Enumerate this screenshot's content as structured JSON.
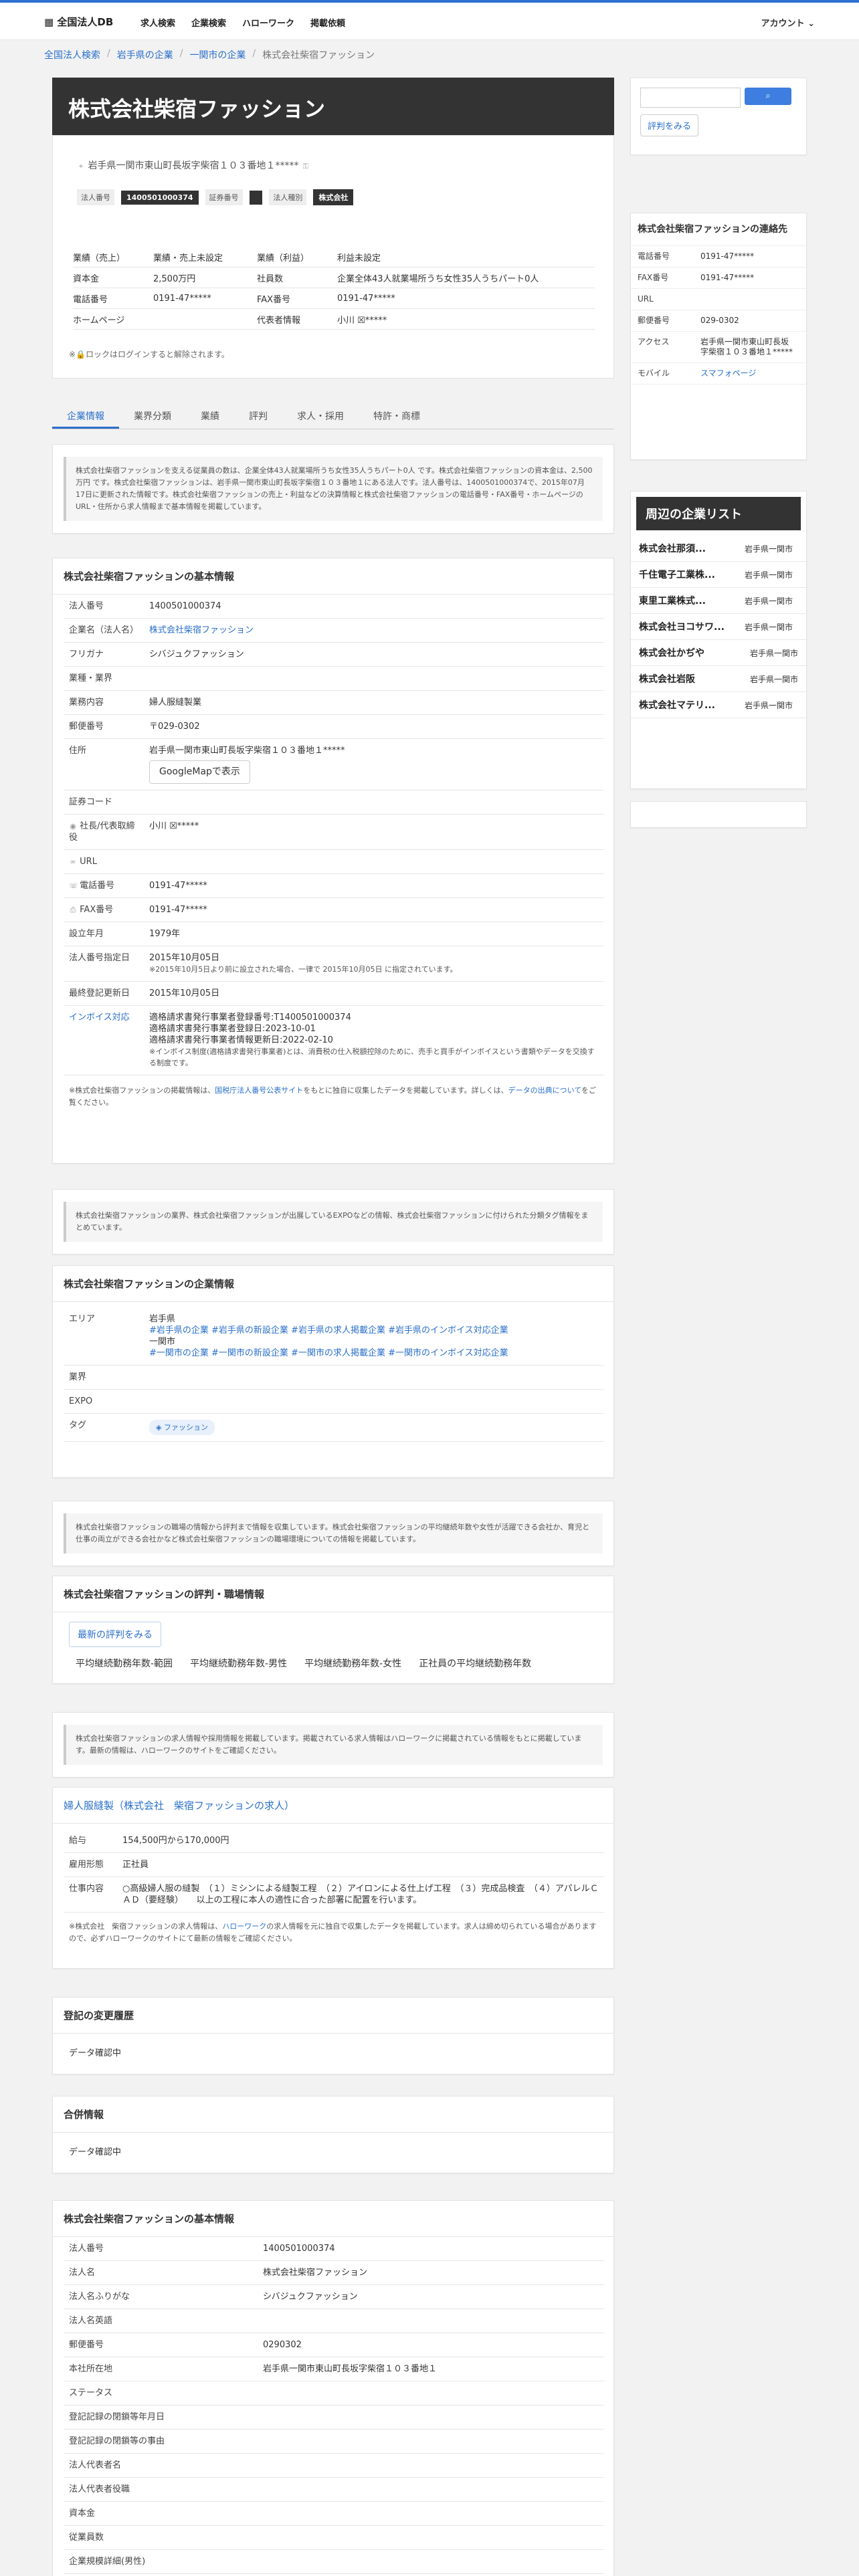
{
  "header": {
    "logo": "全国法人DB",
    "nav": [
      "求人検索",
      "企業検索",
      "ハローワーク",
      "掲載依頼"
    ],
    "account": "アカウント"
  },
  "breadcrumb": [
    "全国法人検索",
    "岩手県の企業",
    "一関市の企業",
    "株式会社柴宿ファッション"
  ],
  "company": {
    "name": "株式会社柴宿ファッション",
    "address": "岩手県一関市東山町長坂字柴宿１０３番地１*****",
    "corp_no_label": "法人番号",
    "corp_no": "1400501000374",
    "stock_label": "証券番号",
    "type_label": "法人種別",
    "type": "株式会社",
    "lock_note": "※🔒ロックはログインすると解除されます。"
  },
  "summary": [
    [
      "業績（売上）",
      "業績・売上未設定",
      "業績（利益）",
      "利益未設定"
    ],
    [
      "資本金",
      "2,500万円",
      "社員数",
      "企業全体43人就業場所うち女性35人うちパート0人"
    ],
    [
      "電話番号",
      "0191-47*****",
      "FAX番号",
      "0191-47*****"
    ],
    [
      "ホームページ",
      "",
      "代表者情報",
      "小川 ☒*****"
    ]
  ],
  "tabs": [
    "企業情報",
    "業界分類",
    "業績",
    "評判",
    "求人・採用",
    "特許・商標"
  ],
  "intro_text": "株式会社柴宿ファッションを支える従業員の数は、企業全体43人就業場所うち女性35人うちパート0人 です。株式会社柴宿ファッションの資本金は、2,500万円 です。株式会社柴宿ファッションは、岩手県一関市東山町長坂字柴宿１０３番地１にある法人です。法人番号は、1400501000374で、2015年07月17日に更新された情報です。株式会社柴宿ファッションの売上・利益などの決算情報と株式会社柴宿ファッションの電話番号・FAX番号・ホームページのURL・住所から求人情報まで基本情報を掲載しています。",
  "basic": {
    "title": "株式会社柴宿ファッションの基本情報",
    "rows": [
      {
        "k": "法人番号",
        "v": "1400501000374"
      },
      {
        "k": "企業名（法人名）",
        "v": "株式会社柴宿ファッション",
        "link": true
      },
      {
        "k": "フリガナ",
        "v": "シバジュクファッション"
      },
      {
        "k": "業種・業界",
        "v": ""
      },
      {
        "k": "業務内容",
        "v": "婦人服縫製業"
      },
      {
        "k": "郵便番号",
        "v": "〒029-0302"
      },
      {
        "k": "住所",
        "v": "岩手県一関市東山町長坂字柴宿１０３番地１*****",
        "btn": "GoogleMapで表示"
      },
      {
        "k": "証券コード",
        "v": ""
      },
      {
        "k": "社長/代表取締役",
        "v": "小川 ☒*****"
      },
      {
        "k": "URL",
        "v": ""
      },
      {
        "k": "電話番号",
        "v": "0191-47*****"
      },
      {
        "k": "FAX番号",
        "v": "0191-47*****"
      },
      {
        "k": "設立年月",
        "v": "1979年"
      },
      {
        "k": "法人番号指定日",
        "v": "2015年10月05日",
        "sub": "※2015年10月5日より前に設立された場合、一律で 2015年10月05日 に指定されています。"
      },
      {
        "k": "最終登記更新日",
        "v": "2015年10月05日"
      },
      {
        "k": "インボイス対応",
        "v": "適格請求書発行事業者登録番号:T1400501000374",
        "v2": "適格請求書発行事業者登録日:2023-10-01",
        "v3": "適格請求書発行事業者情報更新日:2022-02-10",
        "sub": "※インボイス制度(適格請求書発行事業者)とは、消費税の仕入税額控除のために、売手と買手がインボイスという書類やデータを交換する制度です。",
        "link": true
      }
    ],
    "note_pre": "※株式会社柴宿ファッションの掲載情報は、",
    "note_link": "国税庁法人番号公表サイト",
    "note_mid": "をもとに独自に収集したデータを掲載しています。詳しくは、",
    "note_link2": "データの出典について",
    "note_post": "をご覧ください。"
  },
  "industry_intro": "株式会社柴宿ファッションの業界、株式会社柴宿ファッションが出展しているEXPOなどの情報、株式会社柴宿ファッションに付けられた分類タグ情報をまとめています。",
  "industry": {
    "title": "株式会社柴宿ファッションの企業情報",
    "area_label": "エリア",
    "area_pref": "岩手県",
    "area_pref_tags": "#岩手県の企業 #岩手県の新設企業 #岩手県の求人掲載企業 #岩手県のインボイス対応企業",
    "area_city": "一関市",
    "area_city_tags": "#一関市の企業 #一関市の新設企業 #一関市の求人掲載企業 #一関市のインボイス対応企業",
    "industry_label": "業界",
    "expo_label": "EXPO",
    "tag_label": "タグ",
    "tag": "ファッション"
  },
  "reputation_intro": "株式会社柴宿ファッションの職場の情報から評判まで情報を収集しています。株式会社柴宿ファッションの平均継続年数や女性が活躍できる会社か、育児と仕事の両立ができる会社かなど株式会社柴宿ファッションの職場環境についての情報を掲載しています。",
  "reputation": {
    "title": "株式会社柴宿ファッションの評判・職場情報",
    "button": "最新の評判をみる",
    "cols": [
      "平均継続勤務年数-範囲",
      "平均継続勤務年数-男性",
      "平均継続勤務年数-女性",
      "正社員の平均継続勤務年数"
    ]
  },
  "jobs_intro": "株式会社柴宿ファッションの求人情報や採用情報を掲載しています。掲載されている求人情報はハローワークに掲載されている情報をもとに掲載しています。最新の情報は、ハローワークのサイトをご確認ください。",
  "jobs": {
    "title": "婦人服縫製（株式会社　柴宿ファッションの求人）",
    "rows": [
      {
        "k": "給与",
        "v": "154,500円から170,000円"
      },
      {
        "k": "雇用形態",
        "v": "正社員"
      },
      {
        "k": "仕事内容",
        "v": "○高級婦人服の縫製　（１）ミシンによる縫製工程　（２）アイロンによる仕上げ工程　（３）完成品検査　（４）アパレルＣＡＤ（要経験）　　以上の工程に本人の適性に合った部署に配置を行います。"
      }
    ],
    "note_pre": "※株式会社　柴宿ファッションの求人情報は、",
    "note_link": "ハローワーク",
    "note_post": "の求人情報を元に独自で収集したデータを掲載しています。求人は締め切られている場合がありますので、必ずハローワークのサイトにて最新の情報をご確認ください。"
  },
  "history": {
    "title": "登記の変更履歴",
    "body": "データ確認中"
  },
  "merge": {
    "title": "合併情報",
    "body": "データ確認中"
  },
  "basic2": {
    "title": "株式会社柴宿ファッションの基本情報",
    "rows": [
      [
        "法人番号",
        "1400501000374"
      ],
      [
        "法人名",
        "株式会社柴宿ファッション"
      ],
      [
        "法人名ふりがな",
        "シバジュクファッション"
      ],
      [
        "法人名英語",
        ""
      ],
      [
        "郵便番号",
        "0290302"
      ],
      [
        "本社所在地",
        "岩手県一関市東山町長坂字柴宿１０３番地１"
      ],
      [
        "ステータス",
        ""
      ],
      [
        "登記記録の閉鎖等年月日",
        ""
      ],
      [
        "登記記録の閉鎖等の事由",
        ""
      ],
      [
        "法人代表者名",
        ""
      ],
      [
        "法人代表者役職",
        ""
      ],
      [
        "資本金",
        ""
      ],
      [
        "従業員数",
        ""
      ],
      [
        "企業規模詳細(男性)",
        ""
      ]
    ]
  },
  "sidebar": {
    "search_placeholder": "",
    "reviews_button": "評判をみる",
    "contact_title": "株式会社柴宿ファッションの連絡先",
    "contact": [
      {
        "k": "電話番号",
        "v": "0191-47*****"
      },
      {
        "k": "FAX番号",
        "v": "0191-47*****"
      },
      {
        "k": "URL",
        "v": ""
      },
      {
        "k": "郵便番号",
        "v": "029-0302"
      },
      {
        "k": "アクセス",
        "v": "岩手県一関市東山町長坂字柴宿１０３番地１*****"
      },
      {
        "k": "モバイル",
        "v": "スマフォページ"
      }
    ],
    "nearby_title": "周辺の企業リスト",
    "nearby": [
      {
        "name": "株式会社那須...",
        "area": "岩手県一関市"
      },
      {
        "name": "千住電子工業株...",
        "area": "岩手県一関市"
      },
      {
        "name": "東里工業株式...",
        "area": "岩手県一関市"
      },
      {
        "name": "株式会社ヨコサワ...",
        "area": "岩手県一関市"
      },
      {
        "name": "株式会社かぢや",
        "area": "岩手県一関市"
      },
      {
        "name": "株式会社岩阪",
        "area": "岩手県一関市"
      },
      {
        "name": "株式会社マテリ...",
        "area": "岩手県一関市"
      }
    ]
  }
}
